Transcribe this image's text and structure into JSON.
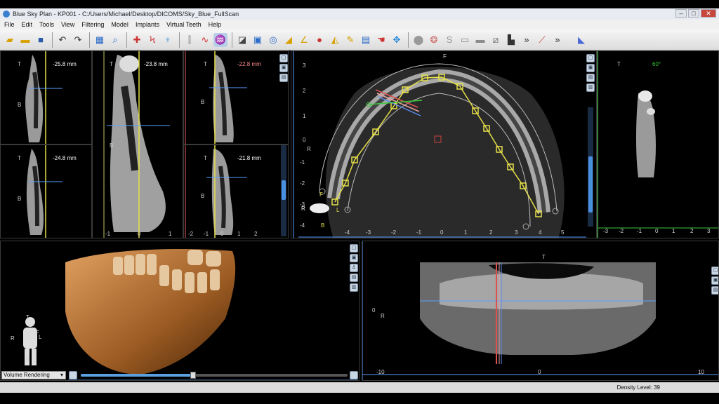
{
  "window": {
    "title": "Blue Sky Plan - KP001 - C:/Users/Michael/Desktop/DICOMS/Sky_Blue_FullScan",
    "minimize": "–",
    "maximize": "□",
    "close": "✕"
  },
  "menu": [
    "File",
    "Edit",
    "Tools",
    "View",
    "Filtering",
    "Model",
    "Implants",
    "Virtual Teeth",
    "Help"
  ],
  "toolbar": {
    "overflow": "»"
  },
  "cross_sections": [
    {
      "distance": "-25.8 mm"
    },
    {
      "distance": "-23.8 mm"
    },
    {
      "distance": "-22.8 mm"
    },
    {
      "distance": "-24.8 mm"
    },
    {
      "distance": "-21.8 mm"
    }
  ],
  "orient": {
    "T": "T",
    "B": "B",
    "R": "R",
    "L": "L",
    "F": "F"
  },
  "axial_ticks_y": [
    "3",
    "2",
    "1",
    "0",
    "-1",
    "-2",
    "-3",
    "-4"
  ],
  "axial_ticks_x": [
    "-4",
    "-3",
    "-2",
    "-1",
    "0",
    "1",
    "2",
    "3",
    "4",
    "5"
  ],
  "right_view": {
    "angle": "60°",
    "ticks_x": [
      "-3",
      "-2",
      "-1",
      "0",
      "1",
      "2",
      "3"
    ]
  },
  "section_ticks_x": [
    "-1",
    "0",
    "1"
  ],
  "section_ticks_x2": [
    "-2",
    "-1",
    "0",
    "1",
    "2"
  ],
  "pano_ticks": [
    "-10",
    "0",
    "10"
  ],
  "pano_axis": {
    "zero": "0"
  },
  "volume": {
    "mode": "Volume Rendering",
    "slider_level": 0.42
  },
  "status": {
    "density": "Density Level: 39"
  }
}
